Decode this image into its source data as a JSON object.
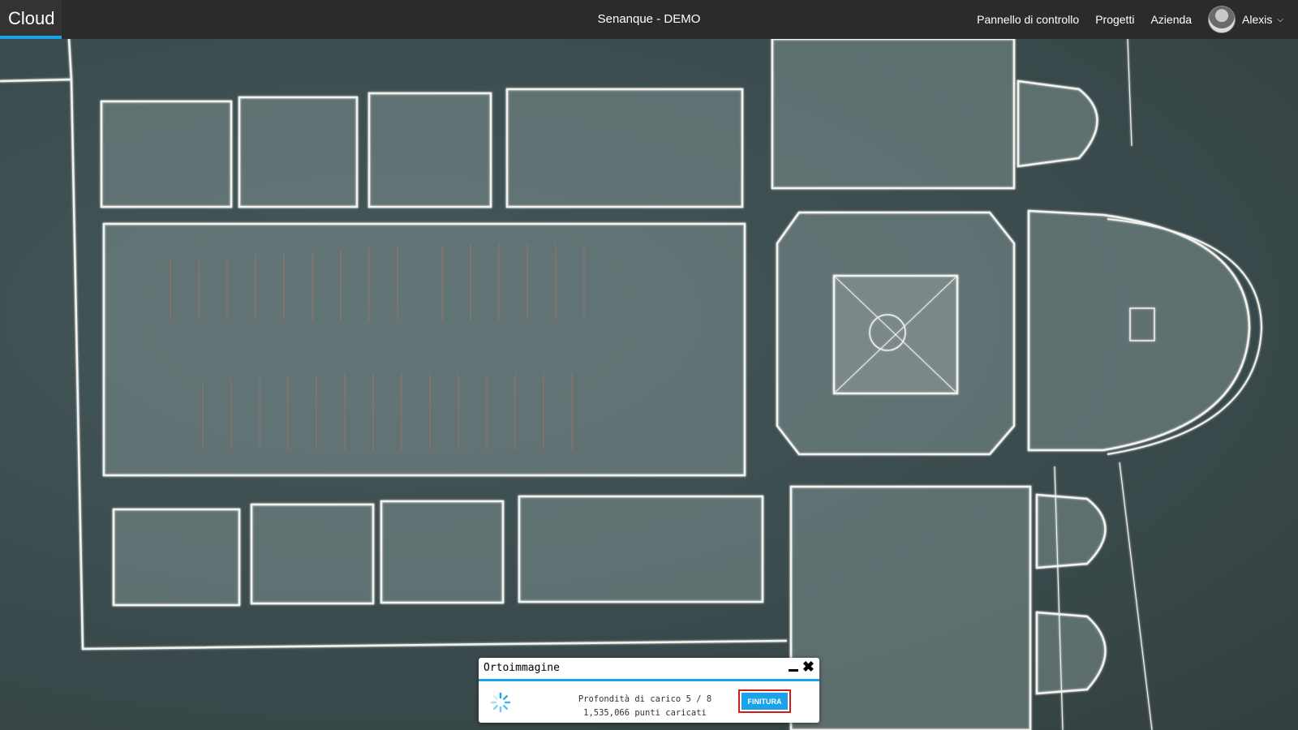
{
  "header": {
    "brand": "Cloud",
    "project_title": "Senanque - DEMO",
    "nav": [
      "Pannello di controllo",
      "Progetti",
      "Azienda"
    ],
    "user": "Alexis"
  },
  "icons": {
    "avatar": "user-avatar",
    "chevron": "chevron-down-icon",
    "minimize": "minimize-icon",
    "close": "close-icon",
    "spinner": "loading-spinner-icon"
  },
  "colors": {
    "accent": "#1aa3e8",
    "highlight": "#d01c1c",
    "topbar": "#2b2b2b"
  },
  "panel": {
    "title": "Ortoimmagine",
    "depth_line": "Profondità di carico 5 / 8",
    "points_line": "1,535,066 punti caricati",
    "finish_label": "FINITURA"
  }
}
